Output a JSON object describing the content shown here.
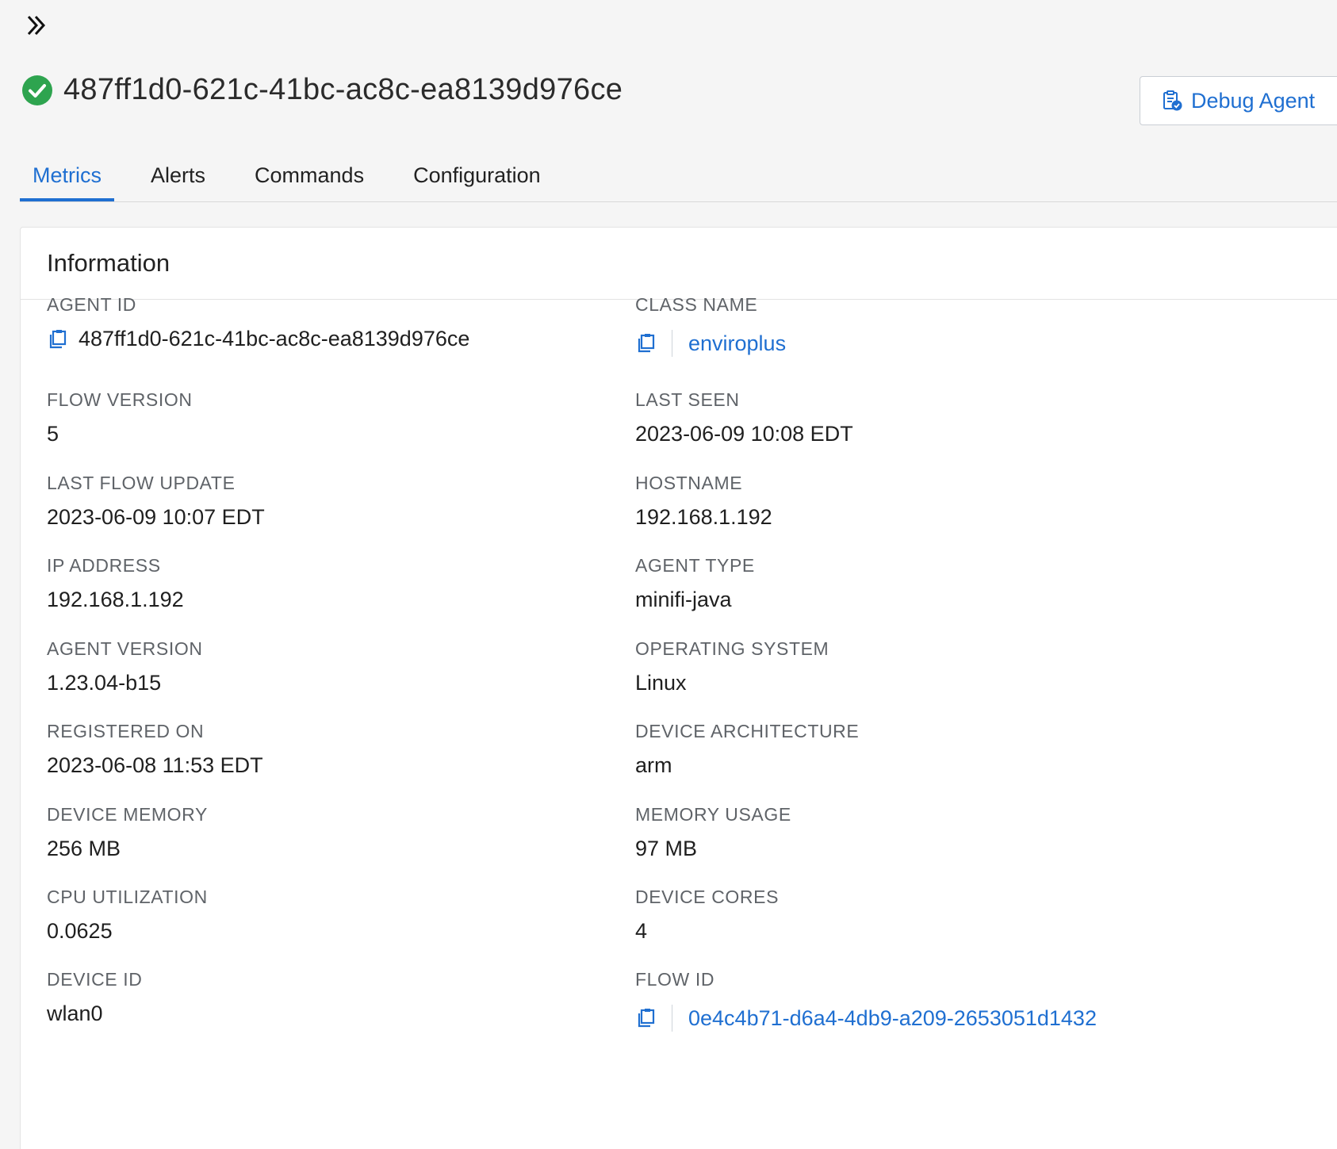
{
  "nav": {
    "expand_icon": "double-chevron-right-icon"
  },
  "header": {
    "status": "connected",
    "status_icon": "check-circle-icon",
    "status_color": "#2ea44f",
    "title": "487ff1d0-621c-41bc-ac8c-ea8139d976ce",
    "debug_button": {
      "label": "Debug Agent",
      "icon": "clipboard-check-icon"
    }
  },
  "tabs": [
    {
      "label": "Metrics",
      "active": true
    },
    {
      "label": "Alerts",
      "active": false
    },
    {
      "label": "Commands",
      "active": false
    },
    {
      "label": "Configuration",
      "active": false
    }
  ],
  "info": {
    "title": "Information",
    "fields": {
      "agent_id": {
        "label": "AGENT ID",
        "value": "487ff1d0-621c-41bc-ac8c-ea8139d976ce"
      },
      "class_name": {
        "label": "CLASS NAME",
        "value": "enviroplus"
      },
      "flow_version": {
        "label": "FLOW VERSION",
        "value": "5"
      },
      "last_seen": {
        "label": "LAST SEEN",
        "value": "2023-06-09 10:08 EDT"
      },
      "last_flow_update": {
        "label": "LAST FLOW UPDATE",
        "value": "2023-06-09 10:07 EDT"
      },
      "hostname": {
        "label": "HOSTNAME",
        "value": "192.168.1.192"
      },
      "ip_address": {
        "label": "IP ADDRESS",
        "value": "192.168.1.192"
      },
      "agent_type": {
        "label": "AGENT TYPE",
        "value": "minifi-java"
      },
      "agent_version": {
        "label": "AGENT VERSION",
        "value": "1.23.04-b15"
      },
      "operating_system": {
        "label": "OPERATING SYSTEM",
        "value": "Linux"
      },
      "registered_on": {
        "label": "REGISTERED ON",
        "value": "2023-06-08 11:53 EDT"
      },
      "device_architecture": {
        "label": "DEVICE ARCHITECTURE",
        "value": "arm"
      },
      "device_memory": {
        "label": "DEVICE MEMORY",
        "value": "256 MB"
      },
      "memory_usage": {
        "label": "MEMORY USAGE",
        "value": "97 MB"
      },
      "cpu_utilization": {
        "label": "CPU UTILIZATION",
        "value": "0.0625"
      },
      "device_cores": {
        "label": "DEVICE CORES",
        "value": "4"
      },
      "device_id": {
        "label": "DEVICE ID",
        "value": "wlan0"
      },
      "flow_id": {
        "label": "FLOW ID",
        "value": "0e4c4b71-d6a4-4db9-a209-2653051d1432"
      }
    }
  },
  "colors": {
    "accent": "#1f6fd1",
    "success": "#2ea44f"
  }
}
